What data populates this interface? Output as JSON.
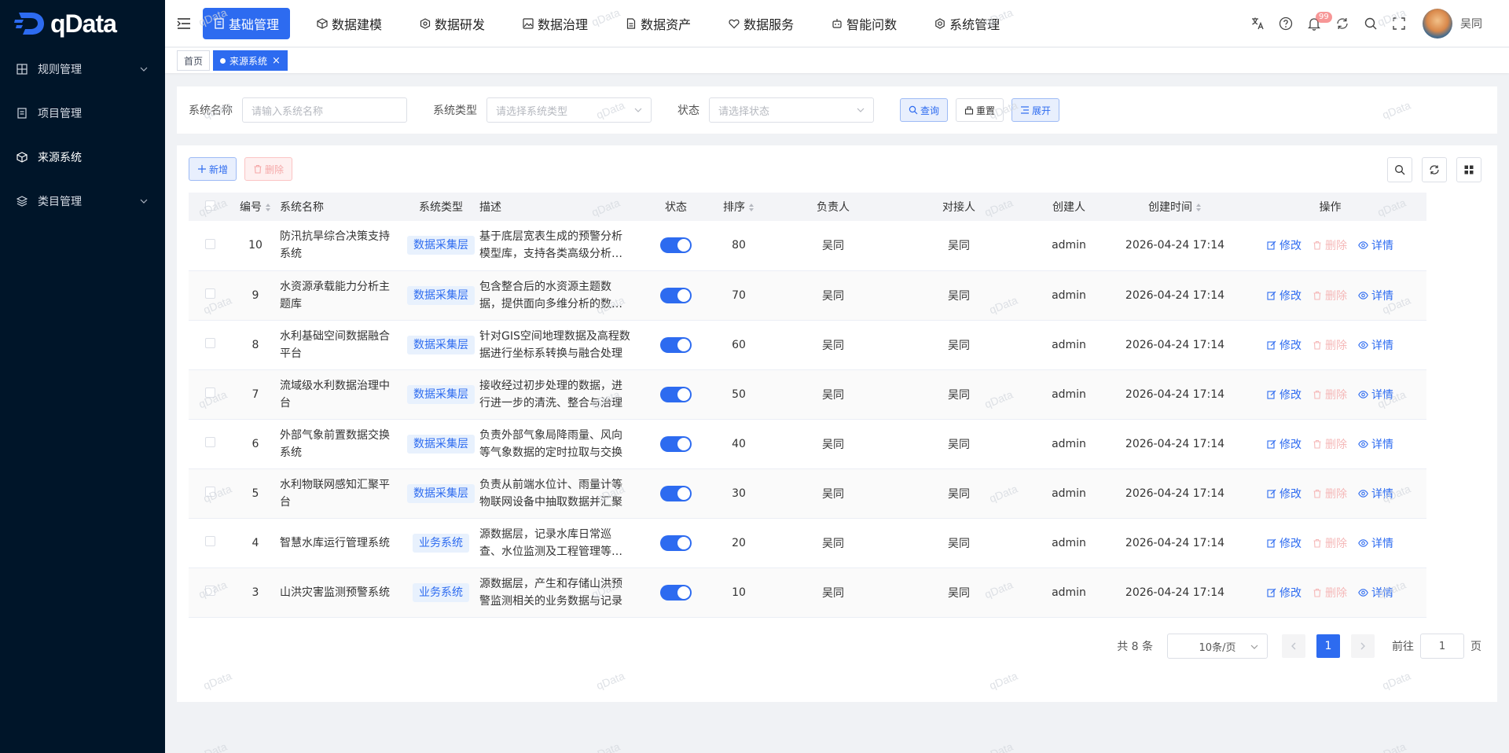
{
  "brand": {
    "logo_text": "qData",
    "accent": "#2d6bf0",
    "sidebar_bg": "#001529"
  },
  "sidebar": {
    "items": [
      {
        "label": "规则管理",
        "icon": "grid-icon",
        "expandable": true
      },
      {
        "label": "项目管理",
        "icon": "document-icon",
        "expandable": false
      },
      {
        "label": "来源系统",
        "icon": "cube-icon",
        "expandable": false,
        "active": true
      },
      {
        "label": "类目管理",
        "icon": "layers-icon",
        "expandable": true
      }
    ]
  },
  "topnav": {
    "items": [
      {
        "label": "基础管理",
        "active": true
      },
      {
        "label": "数据建模"
      },
      {
        "label": "数据研发"
      },
      {
        "label": "数据治理"
      },
      {
        "label": "数据资产"
      },
      {
        "label": "数据服务"
      },
      {
        "label": "智能问数"
      },
      {
        "label": "系统管理"
      }
    ],
    "notify_badge": "99",
    "username": "吴同"
  },
  "tags": {
    "home": "首页",
    "current": "来源系统",
    "close": "×"
  },
  "search": {
    "name_label": "系统名称",
    "name_placeholder": "请输入系统名称",
    "type_label": "系统类型",
    "type_placeholder": "请选择系统类型",
    "status_label": "状态",
    "status_placeholder": "请选择状态",
    "query_btn": "查询",
    "reset_btn": "重置",
    "expand_btn": "展开"
  },
  "toolbar": {
    "add_btn": "新增",
    "delete_btn": "删除"
  },
  "table": {
    "headers": {
      "id": "编号",
      "name": "系统名称",
      "type": "系统类型",
      "desc": "描述",
      "status": "状态",
      "sort": "排序",
      "owner": "负责人",
      "contact": "对接人",
      "creator": "创建人",
      "created": "创建时间",
      "ops": "操作"
    },
    "op_labels": {
      "edit": "修改",
      "delete": "删除",
      "detail": "详情"
    },
    "rows": [
      {
        "id": "10",
        "name": "防汛抗旱综合决策支持系统",
        "type": "数据采集层",
        "desc": "基于底层宽表生成的预警分析模型库，支持各类高级分析应用",
        "status": true,
        "sort": "80",
        "owner": "吴同",
        "contact": "吴同",
        "creator": "admin",
        "created": "2026-04-24 17:14"
      },
      {
        "id": "9",
        "name": "水资源承载能力分析主题库",
        "type": "数据采集层",
        "desc": "包含整合后的水资源主题数据，提供面向多维分析的数据服务",
        "status": true,
        "sort": "70",
        "owner": "吴同",
        "contact": "吴同",
        "creator": "admin",
        "created": "2026-04-24 17:14"
      },
      {
        "id": "8",
        "name": "水利基础空间数据融合平台",
        "type": "数据采集层",
        "desc": "针对GIS空间地理数据及高程数据进行坐标系转换与融合处理",
        "status": true,
        "sort": "60",
        "owner": "吴同",
        "contact": "吴同",
        "creator": "admin",
        "created": "2026-04-24 17:14"
      },
      {
        "id": "7",
        "name": "流域级水利数据治理中台",
        "type": "数据采集层",
        "desc": "接收经过初步处理的数据，进行进一步的清洗、整合与治理",
        "status": true,
        "sort": "50",
        "owner": "吴同",
        "contact": "吴同",
        "creator": "admin",
        "created": "2026-04-24 17:14"
      },
      {
        "id": "6",
        "name": "外部气象前置数据交换系统",
        "type": "数据采集层",
        "desc": "负责外部气象局降雨量、风向等气象数据的定时拉取与交换",
        "status": true,
        "sort": "40",
        "owner": "吴同",
        "contact": "吴同",
        "creator": "admin",
        "created": "2026-04-24 17:14"
      },
      {
        "id": "5",
        "name": "水利物联网感知汇聚平台",
        "type": "数据采集层",
        "desc": "负责从前端水位计、雨量计等物联网设备中抽取数据并汇聚",
        "status": true,
        "sort": "30",
        "owner": "吴同",
        "contact": "吴同",
        "creator": "admin",
        "created": "2026-04-24 17:14"
      },
      {
        "id": "4",
        "name": "智慧水库运行管理系统",
        "type": "业务系统",
        "desc": "源数据层，记录水库日常巡查、水位监测及工程管理等业务数据",
        "status": true,
        "sort": "20",
        "owner": "吴同",
        "contact": "吴同",
        "creator": "admin",
        "created": "2026-04-24 17:14"
      },
      {
        "id": "3",
        "name": "山洪灾害监测预警系统",
        "type": "业务系统",
        "desc": "源数据层，产生和存储山洪预警监测相关的业务数据与记录",
        "status": true,
        "sort": "10",
        "owner": "吴同",
        "contact": "吴同",
        "creator": "admin",
        "created": "2026-04-24 17:14"
      }
    ]
  },
  "pager": {
    "total": "共 8 条",
    "page_size": "10条/页",
    "current": "1",
    "goto_label": "前往",
    "goto_value": "1",
    "page_unit": "页"
  },
  "watermark": "qData"
}
